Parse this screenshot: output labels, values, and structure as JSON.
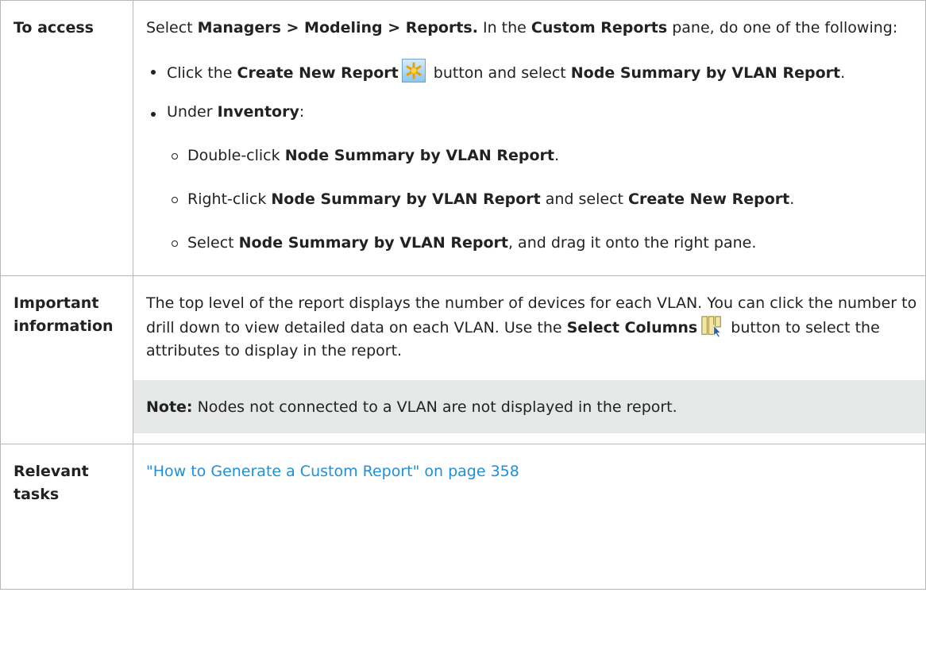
{
  "rows": {
    "access": {
      "label": "To access",
      "intro": {
        "t1": "Select ",
        "path": "Managers > Modeling > Reports.",
        "t2": " In the ",
        "pane": "Custom Reports",
        "t3": " pane, do one of the following:"
      },
      "bullet1": {
        "t1": "Click the ",
        "button": "Create New Report",
        "t2": " button and select ",
        "report": "Node Summary by VLAN Report",
        "t3": "."
      },
      "bullet2": {
        "t1": "Under ",
        "inventory": "Inventory",
        "t2": ":"
      },
      "sub1": {
        "t1": "Double-click ",
        "report": "Node Summary by VLAN Report",
        "t2": "."
      },
      "sub2": {
        "t1": "Right-click ",
        "report": "Node Summary by VLAN Report",
        "t2": " and select ",
        "action": "Create New Report",
        "t3": "."
      },
      "sub3": {
        "t1": "Select ",
        "report": "Node Summary by VLAN Report",
        "t2": ", and drag it onto the right pane."
      }
    },
    "info": {
      "label": "Important information",
      "text": {
        "t1": "The top level of the report displays the number of devices for each VLAN. You can click the number to drill down to view detailed data on each VLAN. Use the ",
        "button": "Select Columns",
        "t2": " button to select the attributes to display in the report."
      },
      "note": {
        "label": "Note:",
        "text": " Nodes not connected to a VLAN are not displayed in the report."
      }
    },
    "tasks": {
      "label": "Relevant tasks",
      "link": "\"How to Generate a Custom Report\" on page 358"
    }
  },
  "icons": {
    "create": "create-new-report-icon",
    "columns": "select-columns-icon"
  }
}
